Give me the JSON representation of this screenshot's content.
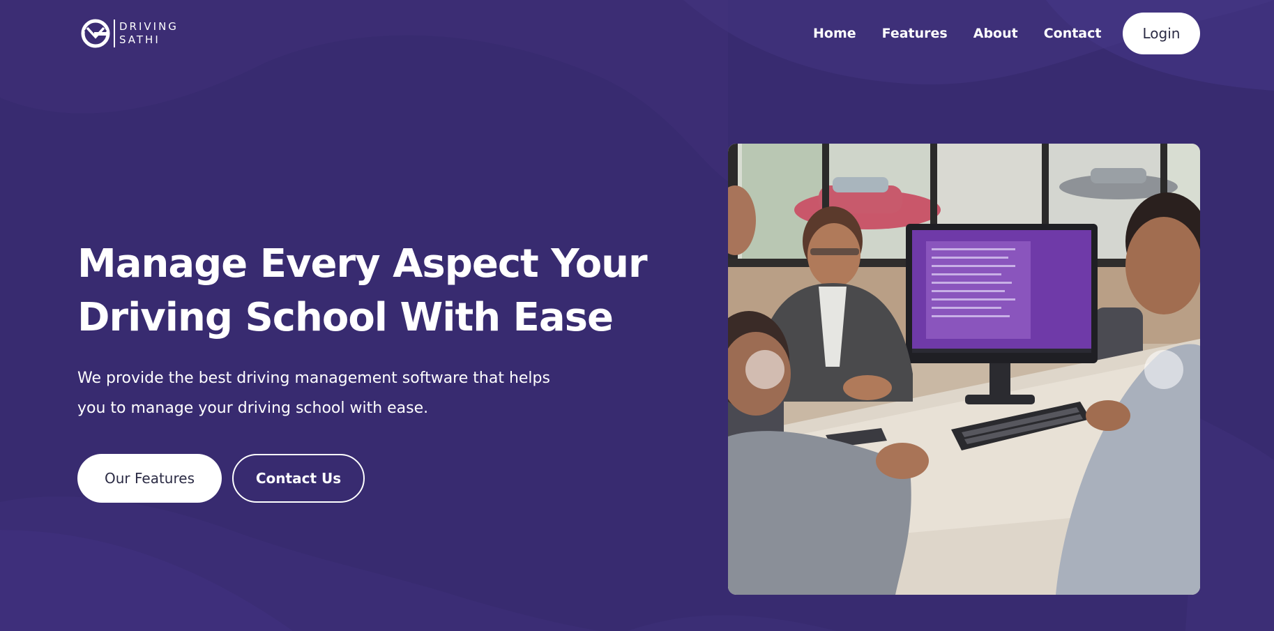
{
  "brand": {
    "line1": "DRIVING",
    "line2": "SATHI"
  },
  "nav": {
    "items": [
      "Home",
      "Features",
      "About",
      "Contact"
    ],
    "login_label": "Login"
  },
  "hero": {
    "title_line1": "Manage Every Aspect Your",
    "title_line2": "Driving School With Ease",
    "subtitle_line1": "We provide the best driving management software that helps",
    "subtitle_line2": "you to manage your driving school with ease.",
    "primary_button": "Our Features",
    "secondary_button": "Contact Us"
  },
  "colors": {
    "background": "#382b70",
    "button_text": "#2b2b44",
    "white": "#ffffff"
  },
  "icons": {
    "carousel_prev": "chevron-left-icon",
    "carousel_next": "chevron-right-icon",
    "logo": "driving-sathi-logo-icon"
  }
}
